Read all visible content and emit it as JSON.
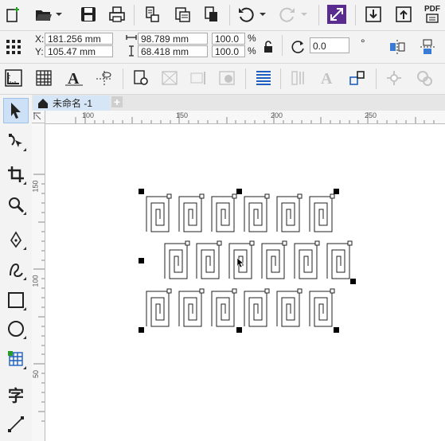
{
  "toolbar": {
    "icons": [
      "new-document-icon",
      "open-icon",
      "save-icon",
      "print-icon",
      "import-icon",
      "export-icon",
      "publish-pdf-icon",
      "undo-icon",
      "redo-icon",
      "weld-icon",
      "download-icon",
      "upload-icon",
      "pdf-icon"
    ],
    "pdf_label": "PDF"
  },
  "properties": {
    "x_label": "X:",
    "x_value": "181.256 mm",
    "y_label": "Y:",
    "y_value": "105.47 mm",
    "width_value": "98.789 mm",
    "height_value": "68.418 mm",
    "scale_x": "100.0",
    "scale_y": "100.0",
    "percent": "%",
    "rotation_value": "0.0",
    "degree": "°"
  },
  "document": {
    "tab_title": "未命名 -1",
    "add_tab_label": "+"
  },
  "rulers": {
    "h_ticks": [
      "100",
      "150",
      "200",
      "250"
    ],
    "v_ticks": [
      "150",
      "100",
      "50"
    ]
  },
  "toolbox": {
    "text_tool_label": "字"
  },
  "colors": {
    "accent": "#5b2c8f",
    "active_tool_bg": "#cde0f5",
    "tab_bg": "#d6e6f7"
  }
}
